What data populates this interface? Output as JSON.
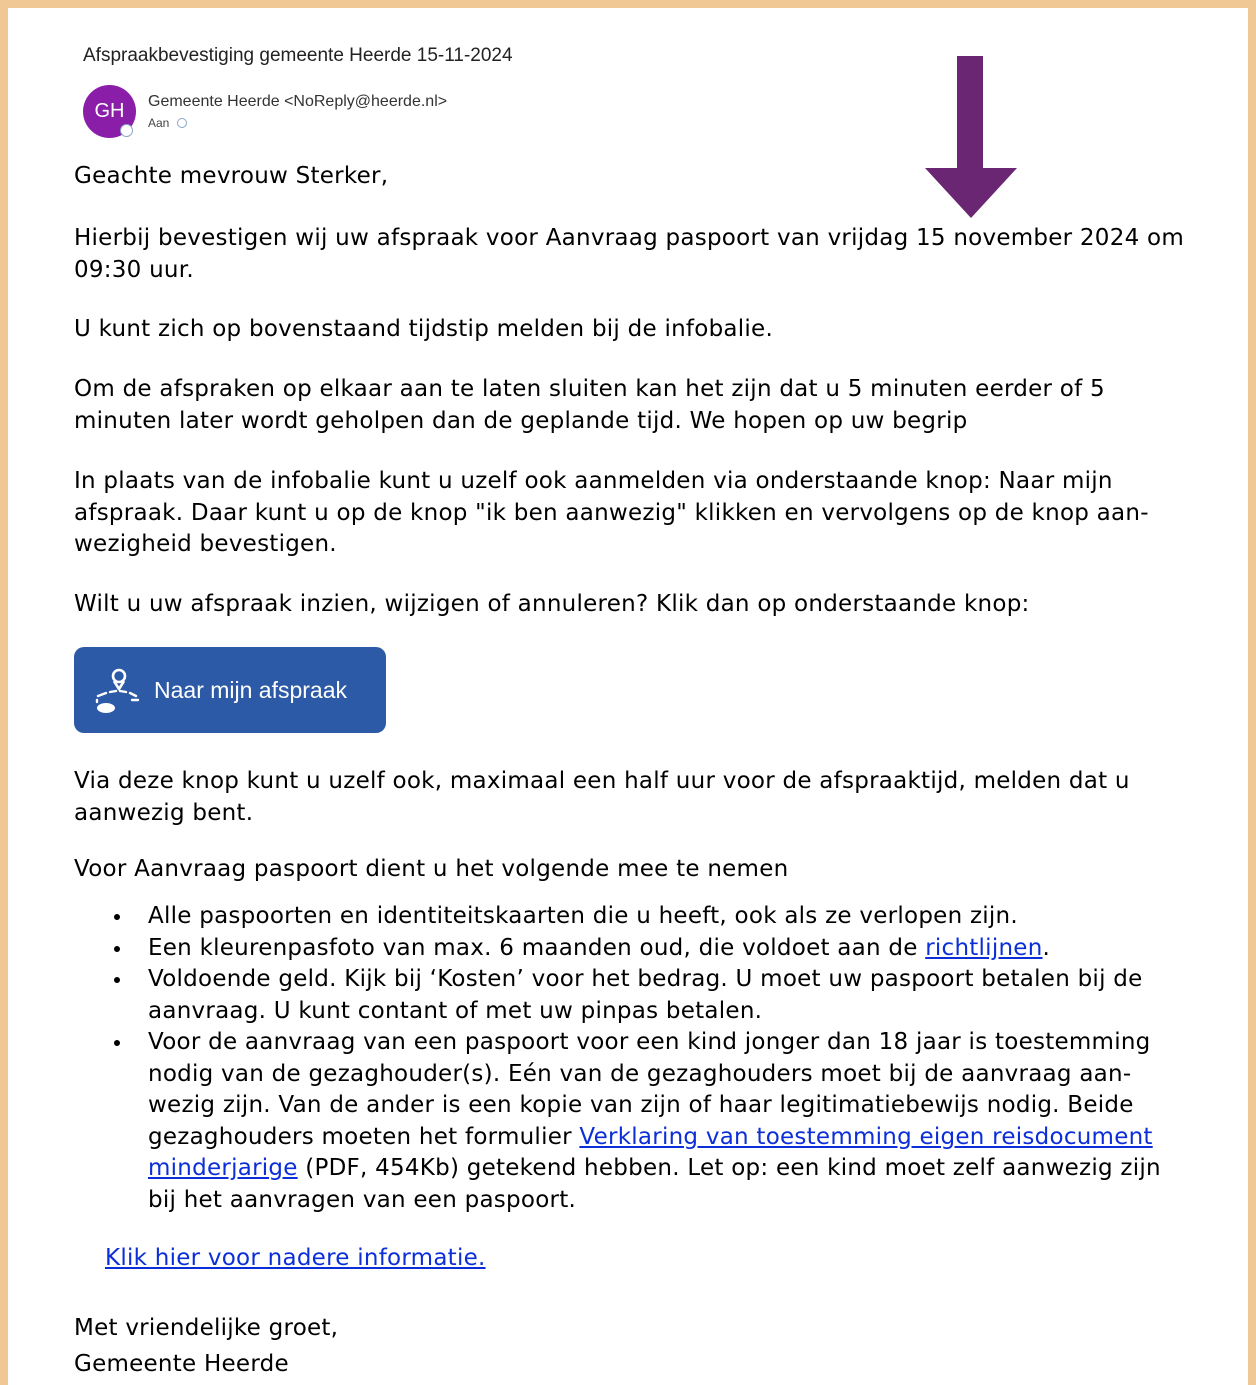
{
  "email": {
    "subject": "Afspraakbevestiging gemeente Heerde 15-11-2024",
    "sender": "Gemeente Heerde <NoReply@heerde.nl>",
    "avatar_initials": "GH",
    "to_label": "Aan",
    "avatar_color": "#8a1ea8"
  },
  "annotation": {
    "arrow_color": "#6b2673"
  },
  "body": {
    "greeting": "Geachte mevrouw Sterker,",
    "p1": "Hierbij bevestigen wij uw afspraak voor Aanvraag paspoort van vrijdag 15 november 2024 om 09:30 uur.",
    "p2": "U kunt zich op bovenstaand tijdstip melden bij de infobalie.",
    "p3": "Om de afspraken op elkaar aan te laten sluiten kan het zijn dat u 5 minuten eerder of 5 minuten later wordt geholpen dan de geplande tijd. We hopen op uw begrip",
    "p4": "In plaats van de infobalie kunt u uzelf ook aanmelden via onderstaande knop: Naar mijn afspraak. Daar kunt u op de knop \"ik ben aanwezig\" klikken en vervolgens op de knop aan-wezigheid bevestigen.",
    "p5": "Wilt u uw afspraak inzien, wijzigen of annuleren? Klik dan op onderstaande knop:",
    "button_label": "Naar mijn afspraak",
    "button_color": "#2d5aa6",
    "p6": "Via deze knop kunt u uzelf ook, maximaal een half uur voor de afspraaktijd, melden dat u aanwezig bent.",
    "p7": "Voor Aanvraag paspoort dient u het volgende mee te nemen",
    "list": {
      "item1": "Alle paspoorten en identiteitskaarten die u heeft, ook als ze verlopen zijn.",
      "item2_pre": "Een kleurenpasfoto van max. 6 maanden oud, die voldoet aan de ",
      "item2_link": "richtlijnen",
      "item2_post": ".",
      "item3": "Voldoende geld. Kijk bij ‘Kosten’ voor het bedrag. U moet uw paspoort betalen bij de aanvraag. U kunt contant of met uw pinpas betalen.",
      "item4_pre": "Voor de aanvraag van een paspoort voor een kind jonger dan 18 jaar is toestemming nodig van de gezaghouder(s). Eén van de gezaghouders moet bij de aanvraag aan-wezig zijn. Van de ander is een kopie van zijn of haar legitimatiebewijs nodig. Beide gezaghouders moeten het formulier ",
      "item4_link": "Verklaring van toestemming eigen reisdocument minderjarige",
      "item4_post": " (PDF, 454Kb) getekend hebben. Let op: een kind moet zelf aanwezig zijn bij het aanvragen van een paspoort."
    },
    "info_link": "Klik hier voor nadere informatie.",
    "closing": "Met vriendelijke groet,",
    "signature": "Gemeente Heerde"
  }
}
